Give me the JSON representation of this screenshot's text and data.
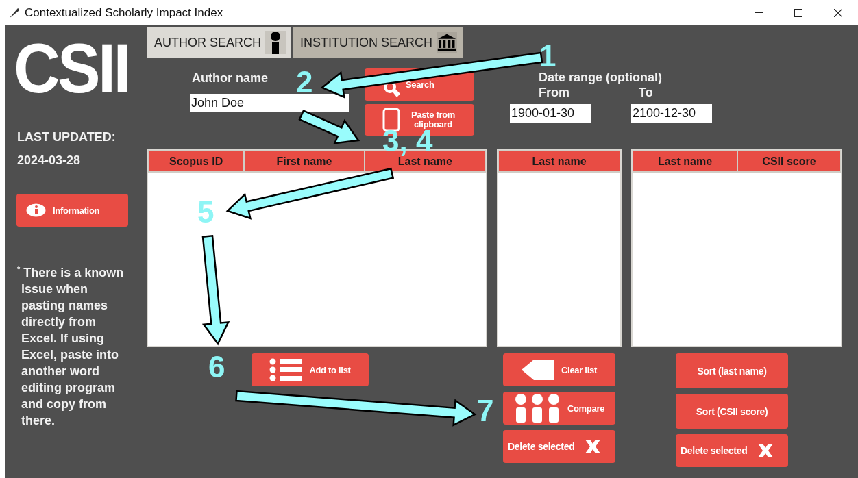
{
  "window": {
    "title": "Contextualized Scholarly Impact Index"
  },
  "sidebar": {
    "logo": "CSII",
    "updated_label": "LAST UPDATED:",
    "updated_date": "2024-03-28",
    "info_button": "Information",
    "note": "$^{*}$ There is a known issue when pasting names directly from Excel. If using Excel, paste into another word editing program and copy from there."
  },
  "tabs": [
    {
      "label": "AUTHOR SEARCH",
      "selected": true
    },
    {
      "label": "INSTITUTION SEARCH",
      "selected": false
    }
  ],
  "author_form": {
    "label": "Author name",
    "value": "John Doe",
    "search_button": "Search",
    "paste_button": "Paste from clipboard"
  },
  "date_range": {
    "label": "Date range (optional)",
    "from_label": "From",
    "from_value": "1900-01-30",
    "to_label": "To",
    "to_value": "2100-12-30"
  },
  "tables": [
    {
      "columns": [
        "Scopus ID",
        "First name",
        "Last name"
      ]
    },
    {
      "columns": [
        "Last name"
      ]
    },
    {
      "columns": [
        "Last name",
        "CSII score"
      ]
    }
  ],
  "button_columns": [
    [
      {
        "label": "Add to list"
      }
    ],
    [
      {
        "label": "Clear list"
      },
      {
        "label": "Compare"
      },
      {
        "label": "Delete selected"
      }
    ],
    [
      {
        "label": "Sort (last name)"
      },
      {
        "label": "Sort (CSII score)"
      },
      {
        "label": "Delete selected"
      }
    ]
  ],
  "annotations": [
    {
      "label": "1"
    },
    {
      "label": "2"
    },
    {
      "label": "3, 4"
    },
    {
      "label": "5"
    },
    {
      "label": "6"
    },
    {
      "label": "7"
    }
  ]
}
